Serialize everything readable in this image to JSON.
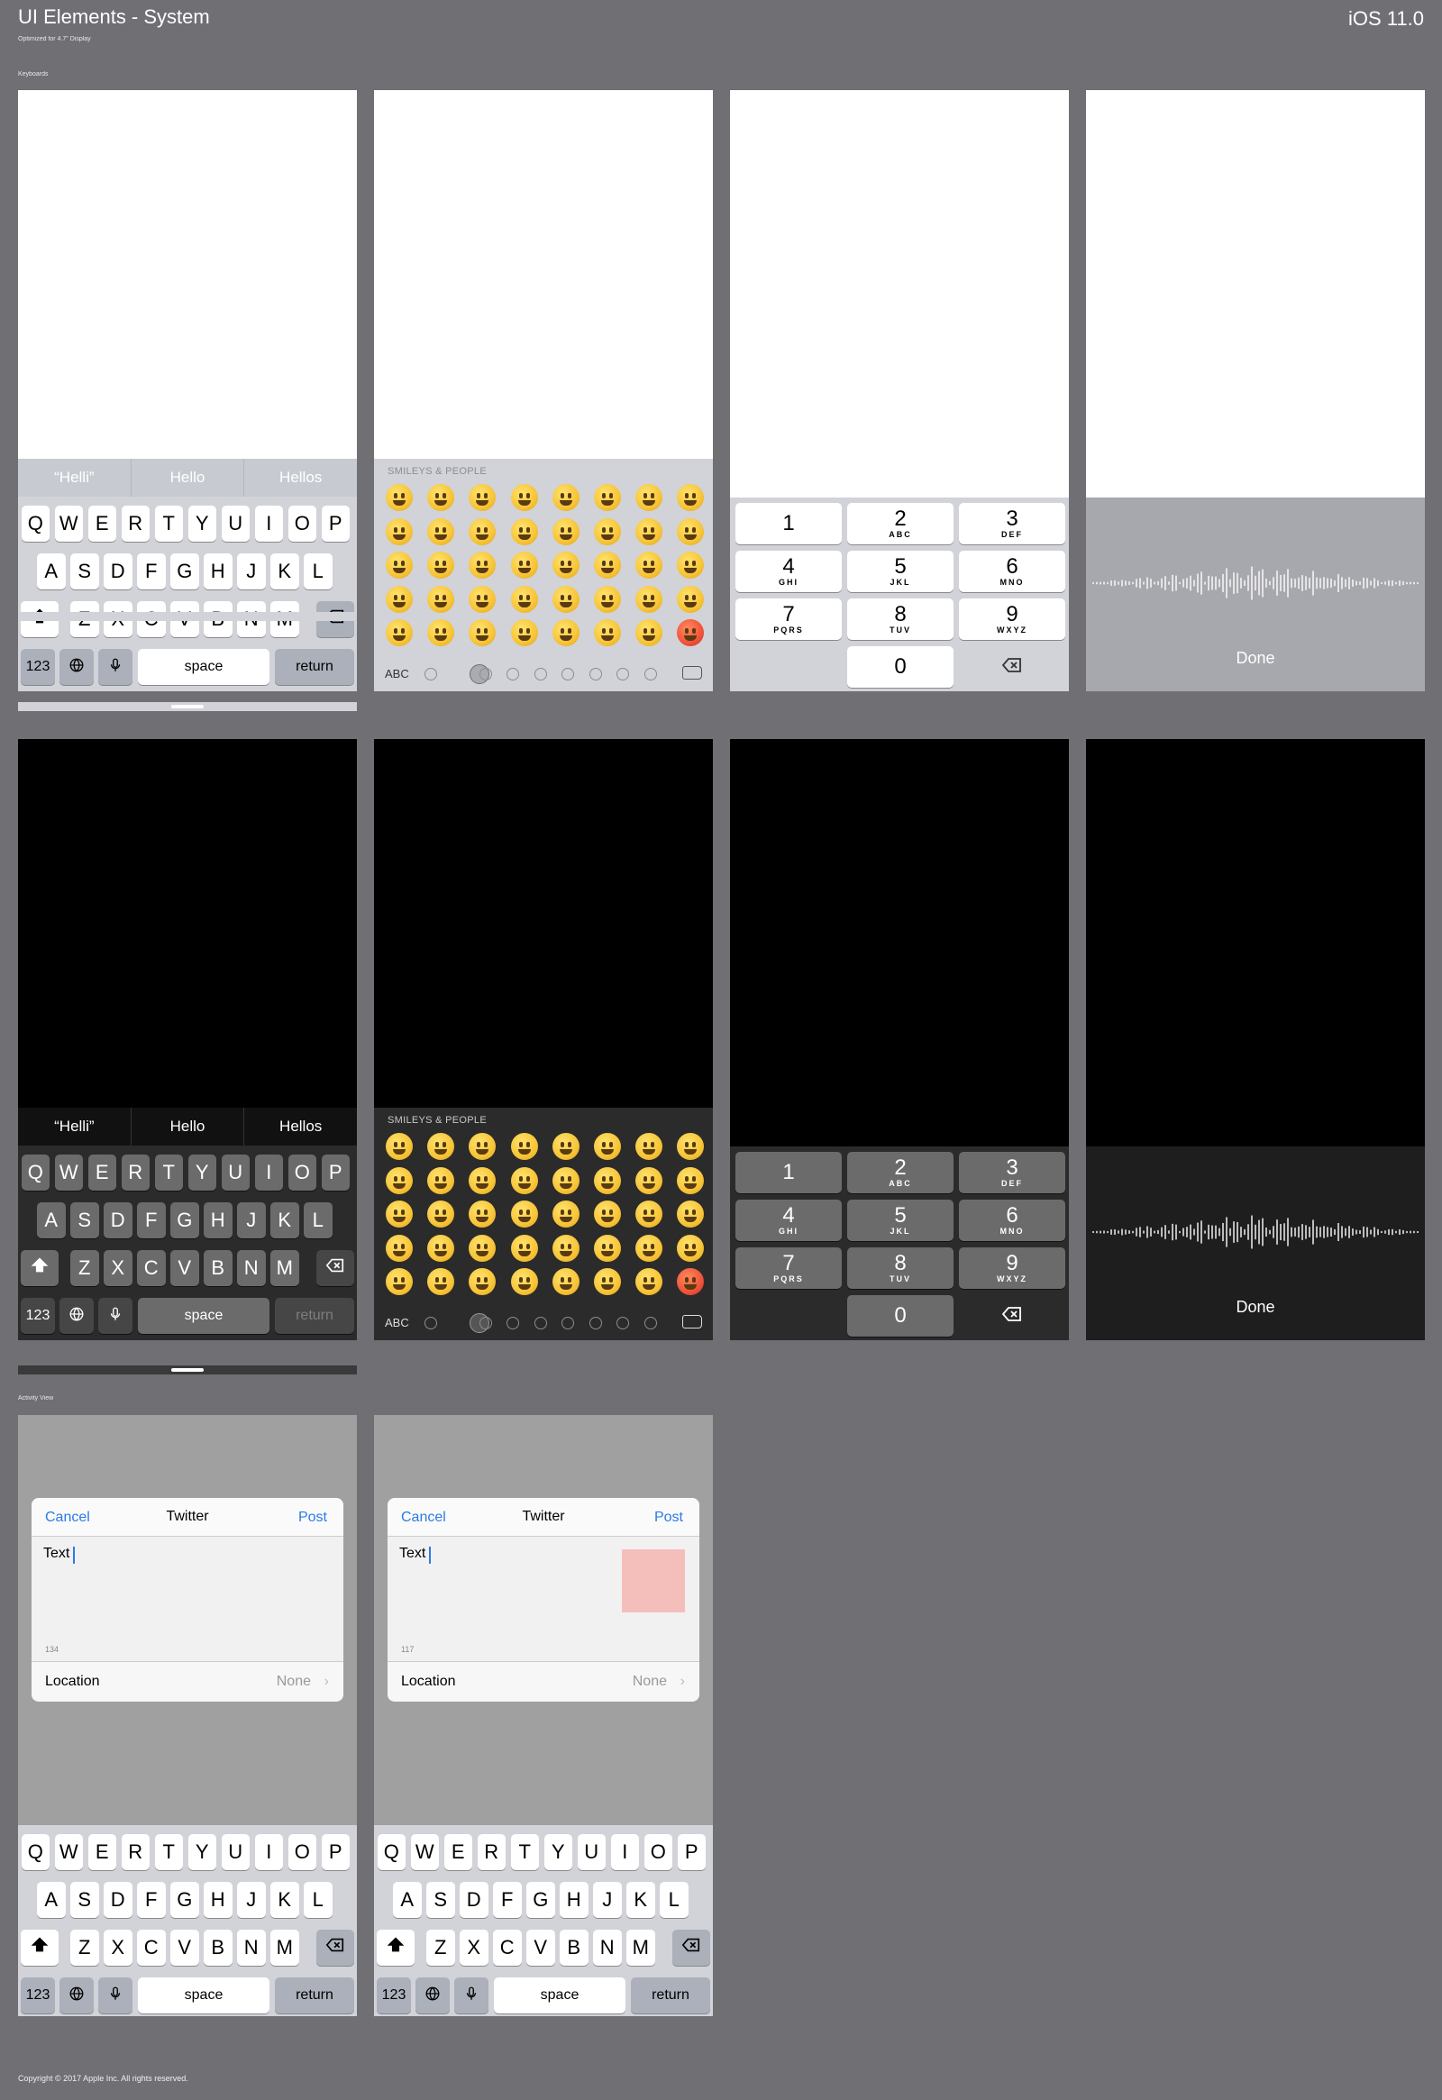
{
  "header": {
    "title": "UI Elements - System",
    "subtitle": "Optimized for 4.7\" Display",
    "version": "iOS 11.0"
  },
  "sections": {
    "keyboards": "Keyboards",
    "activity": "Activity View"
  },
  "keyboard": {
    "predictions": [
      "“Helli”",
      "Hello",
      "Hellos"
    ],
    "row1": [
      "Q",
      "W",
      "E",
      "R",
      "T",
      "Y",
      "U",
      "I",
      "O",
      "P"
    ],
    "row2": [
      "A",
      "S",
      "D",
      "F",
      "G",
      "H",
      "J",
      "K",
      "L"
    ],
    "row3": [
      "Z",
      "X",
      "C",
      "V",
      "B",
      "N",
      "M"
    ],
    "numbers_key": "123",
    "space_key": "space",
    "return_key": "return"
  },
  "emoji": {
    "category": "SMILEYS & PEOPLE",
    "abc_key": "ABC",
    "icons": [
      "clock-icon",
      "smiley-icon",
      "animal-icon",
      "food-icon",
      "ball-icon",
      "car-icon",
      "bulb-icon",
      "symbols-icon",
      "flag-icon"
    ]
  },
  "numpad": {
    "keys": [
      {
        "digit": "1",
        "letters": ""
      },
      {
        "digit": "2",
        "letters": "ABC"
      },
      {
        "digit": "3",
        "letters": "DEF"
      },
      {
        "digit": "4",
        "letters": "GHI"
      },
      {
        "digit": "5",
        "letters": "JKL"
      },
      {
        "digit": "6",
        "letters": "MNO"
      },
      {
        "digit": "7",
        "letters": "PQRS"
      },
      {
        "digit": "8",
        "letters": "TUV"
      },
      {
        "digit": "9",
        "letters": "WXYZ"
      }
    ],
    "zero": "0"
  },
  "dictation": {
    "done": "Done"
  },
  "activity": [
    {
      "cancel": "Cancel",
      "title": "Twitter",
      "post": "Post",
      "text": "Text",
      "count": "134",
      "location_label": "Location",
      "location_value": "None",
      "has_image": false
    },
    {
      "cancel": "Cancel",
      "title": "Twitter",
      "post": "Post",
      "text": "Text",
      "count": "117",
      "location_label": "Location",
      "location_value": "None",
      "has_image": true
    }
  ],
  "colors": {
    "accent": "#2b7be6",
    "background": "#6f6f74",
    "image_placeholder": "#f4bebb"
  },
  "copyright": "Copyright © 2017 Apple Inc. All rights reserved."
}
